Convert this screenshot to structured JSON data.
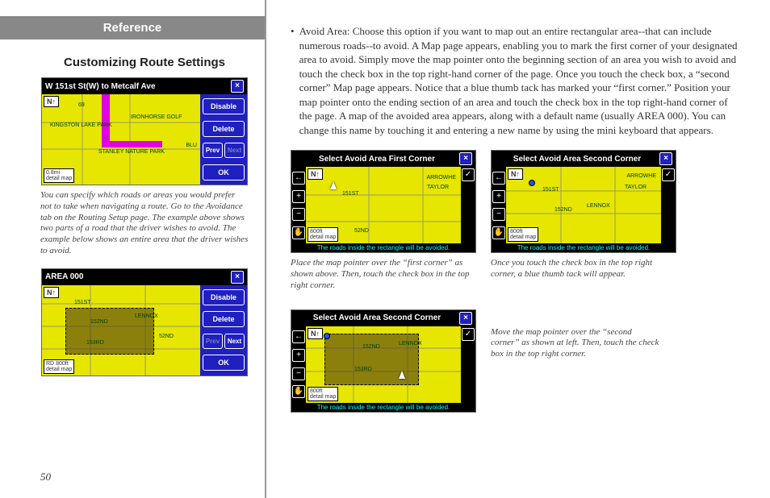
{
  "left": {
    "reference_heading": "Reference",
    "subtitle": "Customizing Route Settings",
    "shot1": {
      "title": "W 151st St(W) to Metcalf Ave",
      "north": "N↑",
      "scale_top": "0.8mi",
      "scale_bot": "detail map",
      "labels": {
        "kingston": "KINGSTON LAKE PARK",
        "ironhorse": "IRONHORSE GOLF",
        "stanley": "STANLEY NATURE PARK",
        "us69": "69",
        "blu": "BLU"
      },
      "btn_disable": "Disable",
      "btn_delete": "Delete",
      "btn_prev": "Prev",
      "btn_next": "Next",
      "btn_ok": "OK"
    },
    "caption1": "You can specify which roads or areas you would prefer not to take when navigating a route. Go to the Avoidance tab on the Routing Setup page. The example above shows two parts of a road that the driver wishes to avoid. The example below shows an entire area that the driver wishes to avoid.",
    "shot2": {
      "title": "AREA 000",
      "north": "N↑",
      "scale_top": "800ft",
      "scale_bot": "detail map",
      "labels": {
        "r151": "151ST",
        "r152": "152ND",
        "r153": "153RD",
        "rd": "RD",
        "lennox": "LENNOX",
        "r52nd": "52ND"
      },
      "btn_disable": "Disable",
      "btn_delete": "Delete",
      "btn_prev": "Prev",
      "btn_next": "Next",
      "btn_ok": "OK"
    }
  },
  "right": {
    "para": "Avoid Area: Choose this option if you want to map out an entire rectangular area--that can include numerous roads--to avoid. A Map page appears, enabling you to mark the first corner of your designated area to avoid. Simply move the map pointer onto the beginning section of an area you wish to avoid and touch the check box in the top right-hand corner of the page. Once you touch the check box, a “second corner” Map page appears. Notice that a blue thumb tack has marked your “first corner.” Position your map pointer onto the ending section of an area and touch the check box in the top right-hand corner of the page. A map of the avoided area appears, along with a default name (usually AREA 000). You can change this name by touching it and entering a new name by using the mini keyboard that appears.",
    "shotA": {
      "title": "Select Avoid Area First Corner",
      "north": "N↑",
      "scale_top": "800ft",
      "scale_bot": "detail map",
      "footer": "The roads inside the rectangle will be avoided.",
      "labels": {
        "r151": "151ST",
        "r52nd": "52ND",
        "taylor": "TAYLOR",
        "arrowh": "ARROWHE"
      }
    },
    "captionA": "Place the map pointer over the “first corner” as shown above. Then, touch the check box in the top right corner.",
    "shotB": {
      "title": "Select Avoid Area Second Corner",
      "north": "N↑",
      "scale_top": "800ft",
      "scale_bot": "detail map",
      "footer": "The roads inside the rectangle will be avoided.",
      "labels": {
        "r151": "151ST",
        "r152": "152ND",
        "lennox": "LENNOX",
        "taylor": "TAYLOR",
        "arrowh": "ARROWHE"
      }
    },
    "captionB": "Once you touch the check box in the top right corner, a blue thumb tack will appear.",
    "shotC": {
      "title": "Select Avoid Area Second Corner",
      "north": "N↑",
      "scale_top": "800ft",
      "scale_bot": "detail map",
      "footer": "The roads inside the rectangle will be avoided.",
      "labels": {
        "r152": "152ND",
        "r153": "153RD",
        "lennox": "LENNOX"
      }
    },
    "captionC": "Move the map pointer over the “second corner” as shown at left. Then, touch the check box in the top right corner."
  },
  "icons": {
    "close": "×",
    "back": "←",
    "plus": "+",
    "minus": "−",
    "hand": "✋",
    "check": "✓"
  },
  "page_number": "50"
}
